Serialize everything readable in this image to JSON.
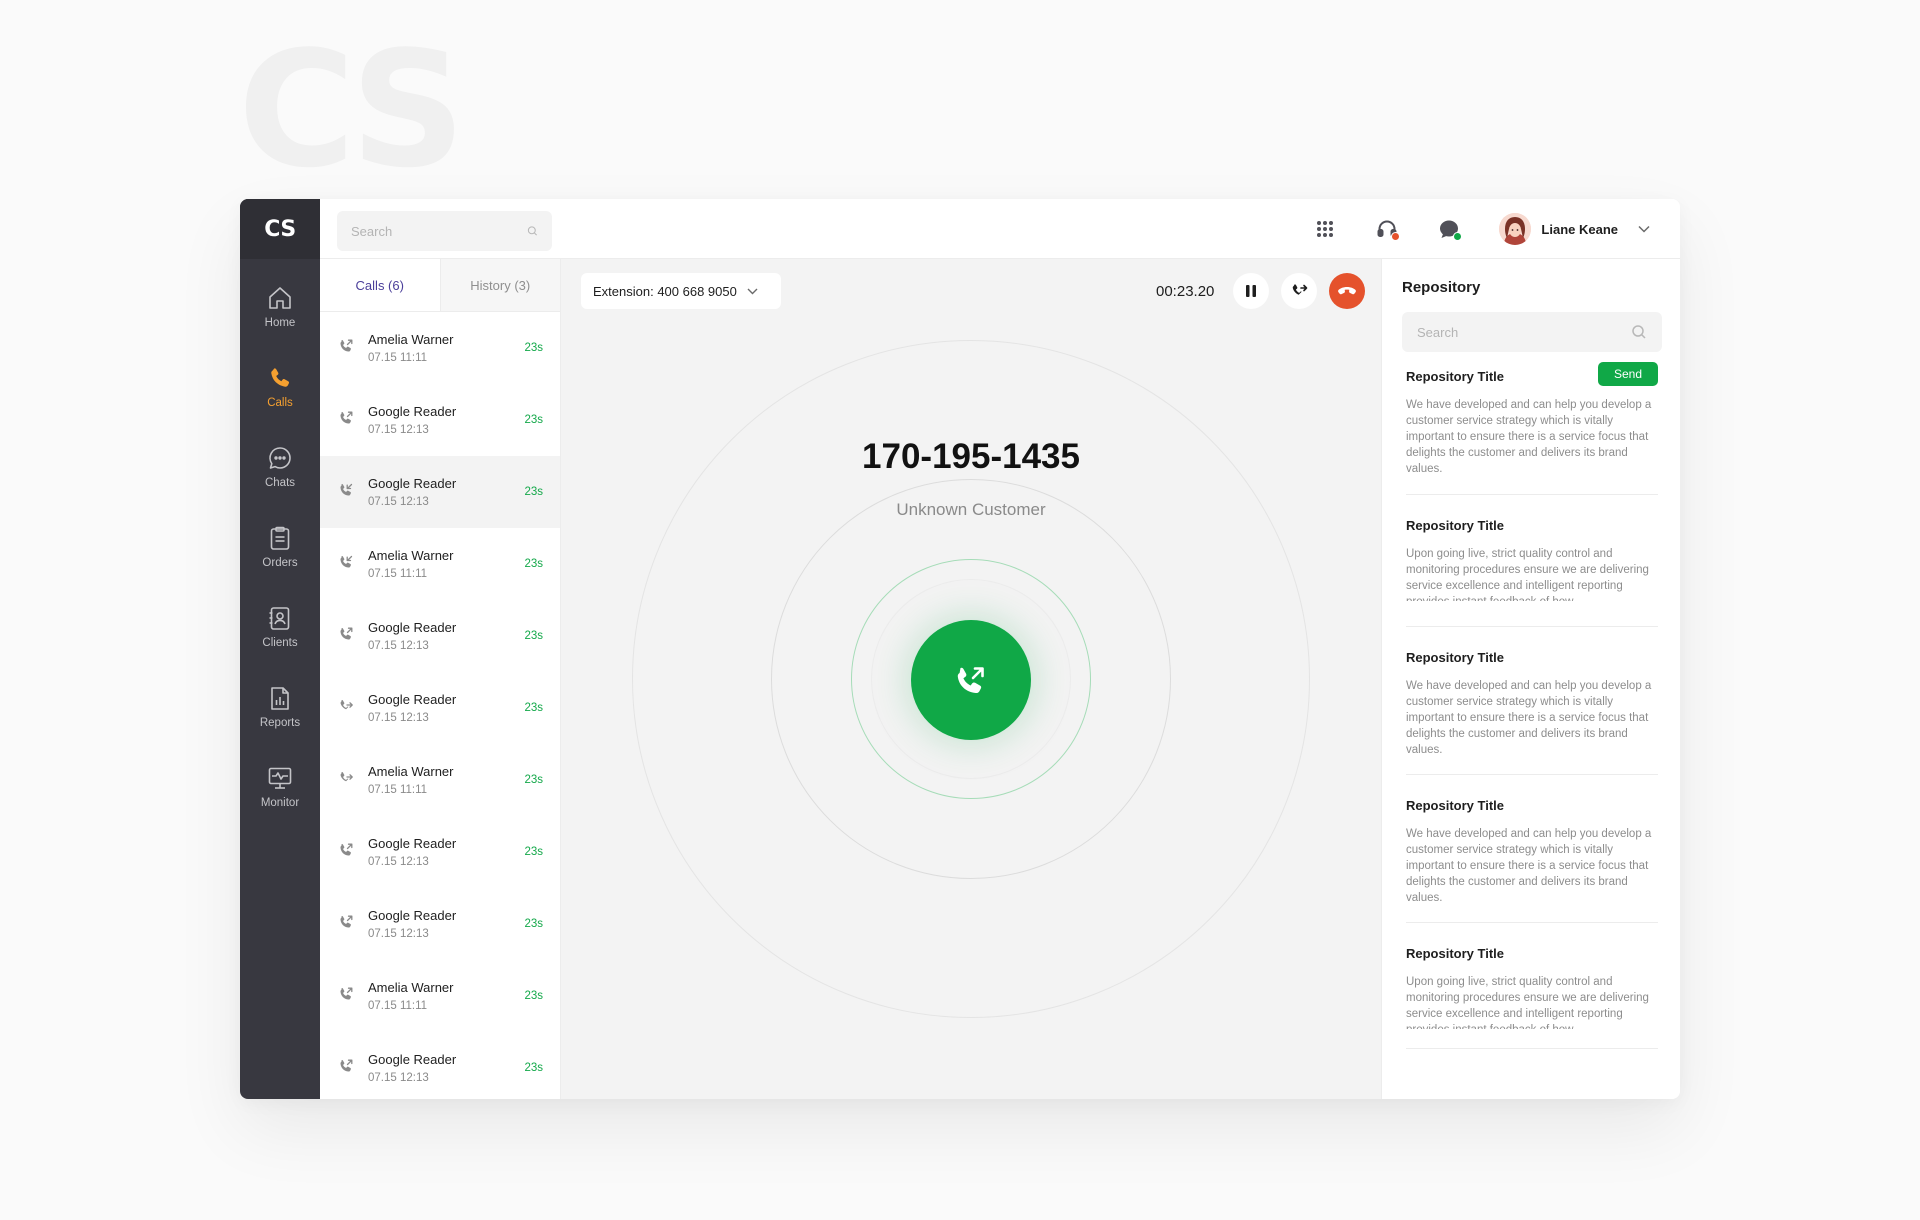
{
  "background_logo": "CS",
  "app": {
    "brand": "CS"
  },
  "sidebar": {
    "items": [
      {
        "label": "Home",
        "icon": "home-icon",
        "active": false
      },
      {
        "label": "Calls",
        "icon": "phone-icon",
        "active": true
      },
      {
        "label": "Chats",
        "icon": "chat-icon",
        "active": false
      },
      {
        "label": "Orders",
        "icon": "clipboard-icon",
        "active": false
      },
      {
        "label": "Clients",
        "icon": "contact-card-icon",
        "active": false
      },
      {
        "label": "Reports",
        "icon": "report-icon",
        "active": false
      },
      {
        "label": "Monitor",
        "icon": "monitor-icon",
        "active": false
      }
    ]
  },
  "topbar": {
    "search_placeholder": "Search",
    "icons": [
      "apps-grid-icon",
      "headset-icon",
      "chat-bubble-icon"
    ],
    "user_name": "Liane Keane"
  },
  "calls": {
    "tabs": {
      "calls": "Calls (6)",
      "history": "History (3)"
    },
    "items": [
      {
        "name": "Amelia Warner",
        "time": "07.15  11:11",
        "duration": "23s",
        "icon": "incoming-call-icon"
      },
      {
        "name": "Google Reader",
        "time": "07.15  12:13",
        "duration": "23s",
        "icon": "incoming-call-icon"
      },
      {
        "name": "Google Reader",
        "time": "07.15  12:13",
        "duration": "23s",
        "icon": "missed-call-icon"
      },
      {
        "name": "Amelia Warner",
        "time": "07.15  11:11",
        "duration": "23s",
        "icon": "missed-call-icon"
      },
      {
        "name": "Google Reader",
        "time": "07.15  12:13",
        "duration": "23s",
        "icon": "incoming-call-icon"
      },
      {
        "name": "Google Reader",
        "time": "07.15  12:13",
        "duration": "23s",
        "icon": "forwarded-call-icon"
      },
      {
        "name": "Amelia Warner",
        "time": "07.15  11:11",
        "duration": "23s",
        "icon": "forwarded-call-icon"
      },
      {
        "name": "Google Reader",
        "time": "07.15  12:13",
        "duration": "23s",
        "icon": "incoming-call-icon"
      },
      {
        "name": "Google Reader",
        "time": "07.15  12:13",
        "duration": "23s",
        "icon": "incoming-call-icon"
      },
      {
        "name": "Amelia Warner",
        "time": "07.15  11:11",
        "duration": "23s",
        "icon": "incoming-call-icon"
      },
      {
        "name": "Google Reader",
        "time": "07.15  12:13",
        "duration": "23s",
        "icon": "incoming-call-icon"
      }
    ]
  },
  "call": {
    "extension": "Extension: 400 668 9050",
    "timer": "00:23.20",
    "number": "170-195-1435",
    "caller": "Unknown Customer",
    "colors": {
      "answer": "#10a847",
      "hangup": "#e5522c"
    }
  },
  "repository": {
    "title": "Repository",
    "search_placeholder": "Search",
    "send_label": "Send",
    "items": [
      {
        "title": "Repository Title",
        "body": "We have developed and can help you develop a customer service strategy which is vitally important to ensure there is a service focus that delights the customer and delivers its brand values."
      },
      {
        "title": "Repository Title",
        "body": "Upon going live, strict quality control and monitoring procedures ensure we are delivering service excellence and intelligent reporting provides instant feedback of how"
      },
      {
        "title": "Repository Title",
        "body": "We have developed and can help you develop a customer service strategy which is vitally important to ensure there is a service focus that delights the customer and delivers its brand values."
      },
      {
        "title": "Repository Title",
        "body": "We have developed and can help you develop a customer service strategy which is vitally important to ensure there is a service focus that delights the customer and delivers its brand values."
      },
      {
        "title": "Repository Title",
        "body": "Upon going live, strict quality control and monitoring procedures ensure we are delivering service excellence and intelligent reporting provides instant feedback of how"
      }
    ]
  }
}
